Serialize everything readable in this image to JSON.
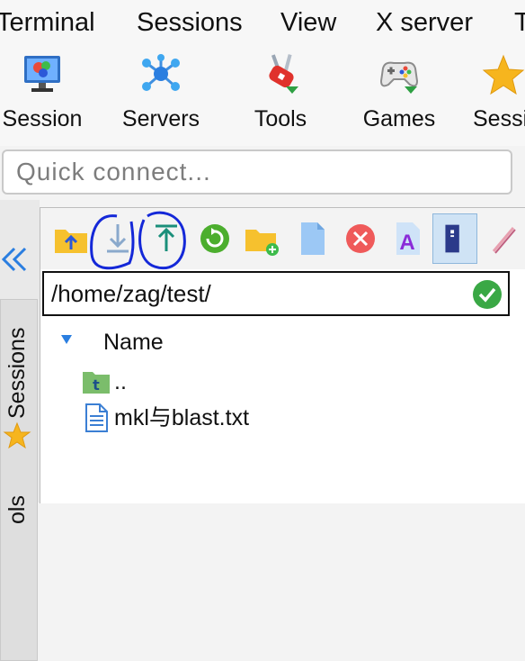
{
  "menubar": {
    "items": [
      {
        "label": "Terminal"
      },
      {
        "label": "Sessions"
      },
      {
        "label": "View"
      },
      {
        "label": "X server"
      },
      {
        "label": "T"
      }
    ]
  },
  "toolbar": {
    "buttons": [
      {
        "label": "Session",
        "icon": "monitor-session-icon"
      },
      {
        "label": "Servers",
        "icon": "servers-network-icon"
      },
      {
        "label": "Tools",
        "icon": "swiss-knife-icon"
      },
      {
        "label": "Games",
        "icon": "gamepad-icon"
      },
      {
        "label": "Sessi",
        "icon": "star-icon"
      }
    ]
  },
  "quick_connect": {
    "placeholder": "Quick connect..."
  },
  "sidebar": {
    "collapse_icon": "double-chevron-left-icon",
    "tabs": [
      {
        "label": "Sessions",
        "icon": "star-icon"
      },
      {
        "label": "ols"
      }
    ]
  },
  "sftp": {
    "toolbar_icons": [
      "parent-folder-icon",
      "download-icon",
      "upload-icon",
      "refresh-icon",
      "new-folder-icon",
      "new-file-icon",
      "delete-icon",
      "rename-icon",
      "follow-terminal-icon",
      "edit-icon"
    ],
    "path": "/home/zag/test/",
    "path_ok_icon": "check-circle-icon",
    "column_header": "Name",
    "files": [
      {
        "name": "..",
        "icon": "parent-folder-icon"
      },
      {
        "name": "mkl与blast.txt",
        "icon": "text-file-icon"
      }
    ]
  },
  "colors": {
    "annotation": "#1428d8",
    "refresh_green": "#4cae2e",
    "ok_green": "#3aa845",
    "delete_red": "#ef5a5a",
    "folder_yellow": "#f6c12e",
    "file_blue": "#5aa0e8"
  }
}
